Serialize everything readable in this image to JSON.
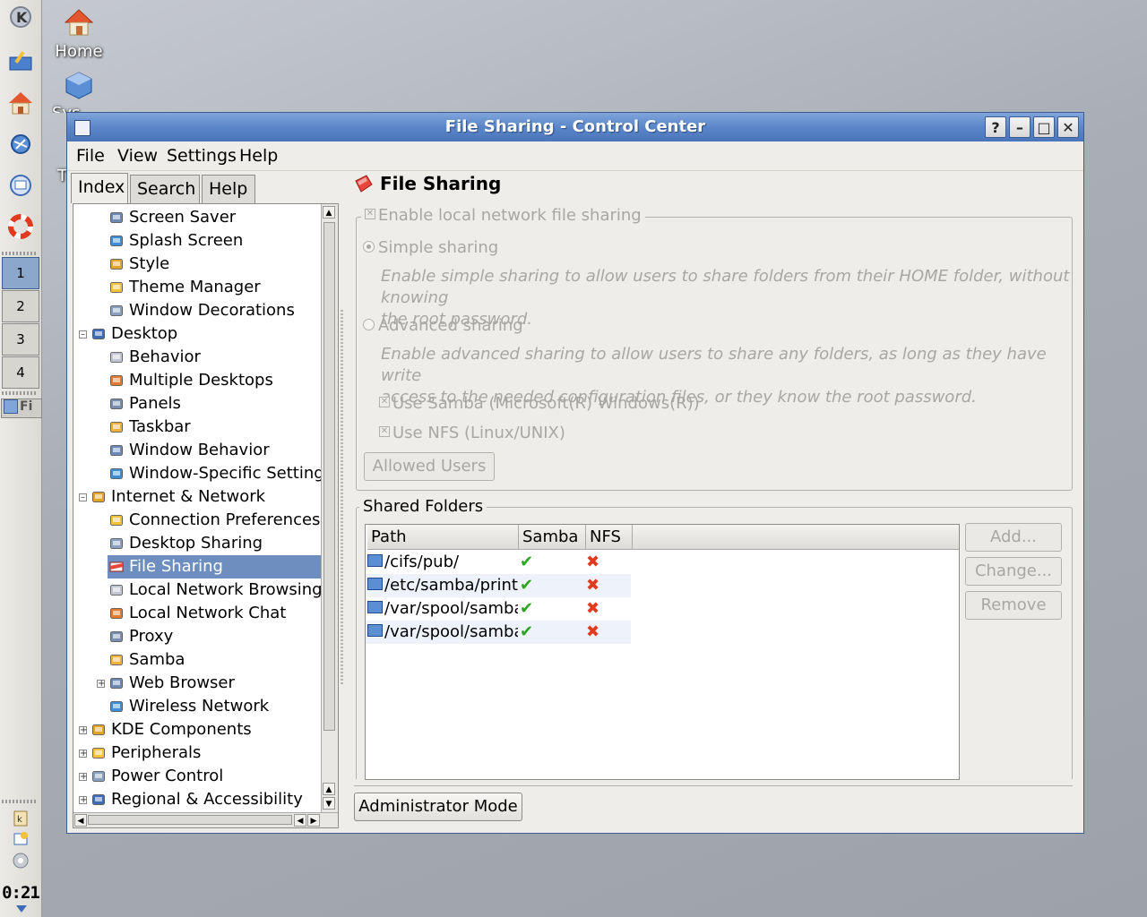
{
  "desktop": {
    "icons": [
      {
        "label": "Home",
        "icon": "home-icon"
      },
      {
        "label": "Sys",
        "icon": "system-icon"
      },
      {
        "label": "T",
        "icon": "trash-icon"
      }
    ]
  },
  "panel": {
    "pager": [
      "1",
      "2",
      "3",
      "4"
    ],
    "active_desktop": "1",
    "task_label": "Fi",
    "clock": "0:21"
  },
  "window": {
    "title": "File Sharing - Control Center",
    "buttons": {
      "help": "?",
      "minimize": "–",
      "maximize": "□",
      "close": "✕"
    },
    "menu": [
      "File",
      "View",
      "Settings",
      "Help"
    ],
    "tabs": [
      "Index",
      "Search",
      "Help"
    ],
    "tree": [
      {
        "label": "Screen Saver",
        "level": 2,
        "icon": "screen-saver-icon"
      },
      {
        "label": "Splash Screen",
        "level": 2,
        "icon": "splash-screen-icon"
      },
      {
        "label": "Style",
        "level": 2,
        "icon": "style-icon"
      },
      {
        "label": "Theme Manager",
        "level": 2,
        "icon": "theme-manager-icon"
      },
      {
        "label": "Window Decorations",
        "level": 2,
        "icon": "window-decorations-icon"
      },
      {
        "label": "Desktop",
        "level": 1,
        "icon": "desktop-icon",
        "expander": "-"
      },
      {
        "label": "Behavior",
        "level": 2,
        "icon": "behavior-icon"
      },
      {
        "label": "Multiple Desktops",
        "level": 2,
        "icon": "multiple-desktops-icon"
      },
      {
        "label": "Panels",
        "level": 2,
        "icon": "panels-icon"
      },
      {
        "label": "Taskbar",
        "level": 2,
        "icon": "taskbar-icon"
      },
      {
        "label": "Window Behavior",
        "level": 2,
        "icon": "window-behavior-icon"
      },
      {
        "label": "Window-Specific Settings",
        "level": 2,
        "icon": "window-specific-icon"
      },
      {
        "label": "Internet & Network",
        "level": 1,
        "icon": "network-icon",
        "expander": "-"
      },
      {
        "label": "Connection Preferences",
        "level": 2,
        "icon": "connection-icon"
      },
      {
        "label": "Desktop Sharing",
        "level": 2,
        "icon": "desktop-sharing-icon"
      },
      {
        "label": "File Sharing",
        "level": 2,
        "icon": "file-sharing-icon",
        "selected": true
      },
      {
        "label": "Local Network Browsing",
        "level": 2,
        "icon": "network-browsing-icon"
      },
      {
        "label": "Local Network Chat",
        "level": 2,
        "icon": "network-chat-icon"
      },
      {
        "label": "Proxy",
        "level": 2,
        "icon": "proxy-icon"
      },
      {
        "label": "Samba",
        "level": 2,
        "icon": "samba-icon"
      },
      {
        "label": "Web Browser",
        "level": 2,
        "icon": "web-browser-icon",
        "expander": "+"
      },
      {
        "label": "Wireless Network",
        "level": 2,
        "icon": "wireless-icon"
      },
      {
        "label": "KDE Components",
        "level": 1,
        "icon": "kde-components-icon",
        "expander": "+"
      },
      {
        "label": "Peripherals",
        "level": 1,
        "icon": "peripherals-icon",
        "expander": "+"
      },
      {
        "label": "Power Control",
        "level": 1,
        "icon": "power-control-icon",
        "expander": "+"
      },
      {
        "label": "Regional & Accessibility",
        "level": 1,
        "icon": "regional-icon",
        "expander": "+"
      }
    ],
    "page": {
      "title": "File Sharing",
      "enable_label": "Enable local network file sharing",
      "simple_label": "Simple sharing",
      "simple_desc_1": "Enable simple sharing to allow users to share folders from their HOME folder, without knowing",
      "simple_desc_2": "the root password.",
      "advanced_label": "Advanced sharing",
      "advanced_desc_1": "Enable advanced sharing to allow users to share any folders, as long as they have write",
      "advanced_desc_2": "access to the needed configuration files, or they know the root password.",
      "samba_label": "Use Samba (Microsoft(R) Windows(R))",
      "nfs_label": "Use NFS (Linux/UNIX)",
      "allowed_users": "Allowed Users",
      "shared_folders_title": "Shared Folders",
      "columns": [
        "Path",
        "Samba",
        "NFS"
      ],
      "rows": [
        {
          "path": "/cifs/pub/",
          "samba": "✔",
          "nfs": "✖"
        },
        {
          "path": "/etc/samba/printer/",
          "samba": "✔",
          "nfs": "✖"
        },
        {
          "path": "/var/spool/samba/",
          "samba": "✔",
          "nfs": "✖"
        },
        {
          "path": "/var/spool/samba/",
          "samba": "✔",
          "nfs": "✖"
        }
      ],
      "add": "Add...",
      "change": "Change...",
      "remove": "Remove",
      "admin_mode": "Administrator Mode"
    }
  }
}
